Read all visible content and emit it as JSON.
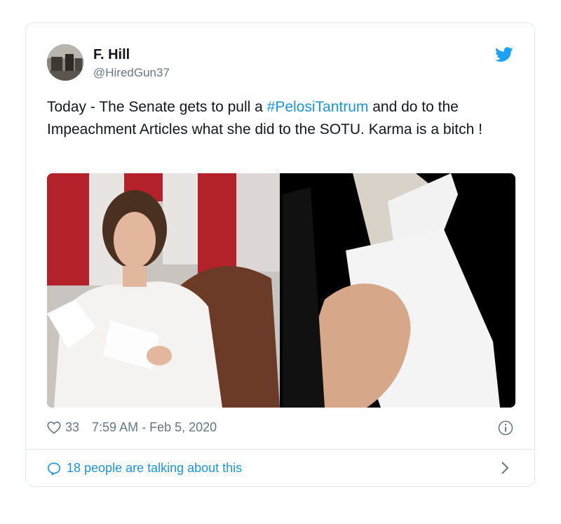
{
  "tweet": {
    "display_name": "F. Hill",
    "handle": "@HiredGun37",
    "text_before": "Today - The Senate gets to pull a ",
    "hashtag": "#PelosiTantrum",
    "text_after": " and do to the Impeachment Articles what she did to the SOTU. Karma is a bitch !",
    "likes": "33",
    "timestamp": "7:59 AM - Feb 5, 2020",
    "talking": "18 people are talking about this"
  },
  "icons": {
    "logo": "twitter-bird-icon",
    "like": "heart-icon",
    "info": "info-icon",
    "reply": "speech-bubble-icon",
    "more": "chevron-right-icon"
  },
  "colors": {
    "link": "#1b95e0",
    "secondary_text": "#657786",
    "border": "#e1e8ed"
  }
}
